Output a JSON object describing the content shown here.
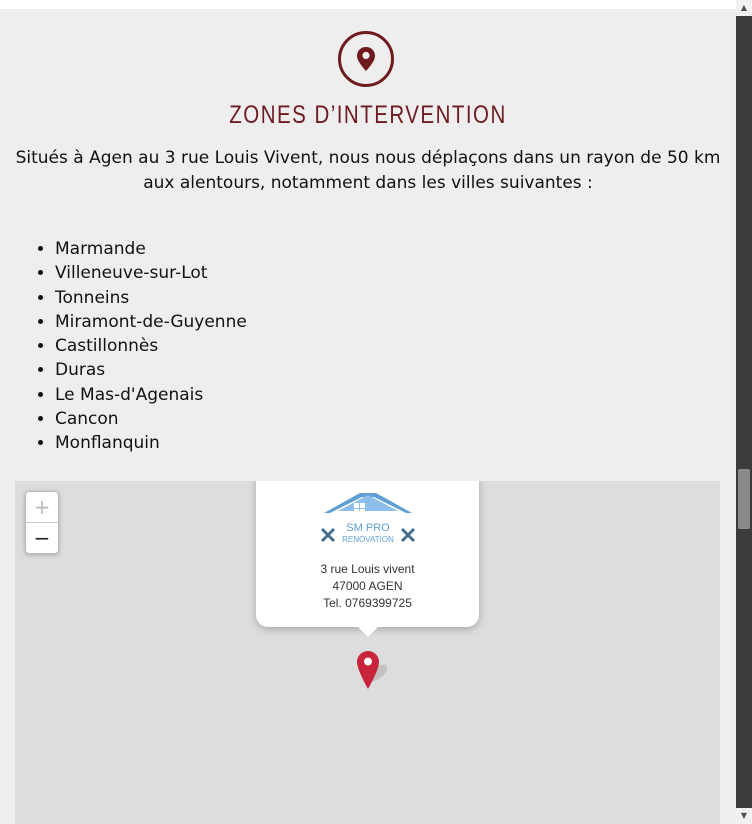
{
  "section": {
    "title": "ZONES D’INTERVENTION",
    "icon": "location-pin-icon",
    "accent_color": "#6e1a1f",
    "intro": "Situés à Agen au 3 rue Louis Vivent, nous nous déplaçons dans un rayon de 50 km aux alentours, notamment dans les villes suivantes :"
  },
  "towns": [
    "Marmande",
    "Villeneuve-sur-Lot",
    "Tonneins",
    "Miramont-de-Guyenne",
    "Castillonnès",
    "Duras",
    "Le Mas-d'Agenais",
    "Cancon",
    "Monflanquin"
  ],
  "map": {
    "zoom_in_label": "+",
    "zoom_out_label": "−",
    "popup": {
      "logo_text_line1": "SM PRO",
      "logo_text_line2": "RENOVATION",
      "address_line1": "3 rue Louis vivent",
      "address_line2": "47000 AGEN",
      "phone": "Tel. 0769399725"
    },
    "marker_color": "#c8243b"
  },
  "scrollbar": {
    "up_icon": "scroll-up-arrow-icon",
    "down_icon": "scroll-down-arrow-icon"
  }
}
